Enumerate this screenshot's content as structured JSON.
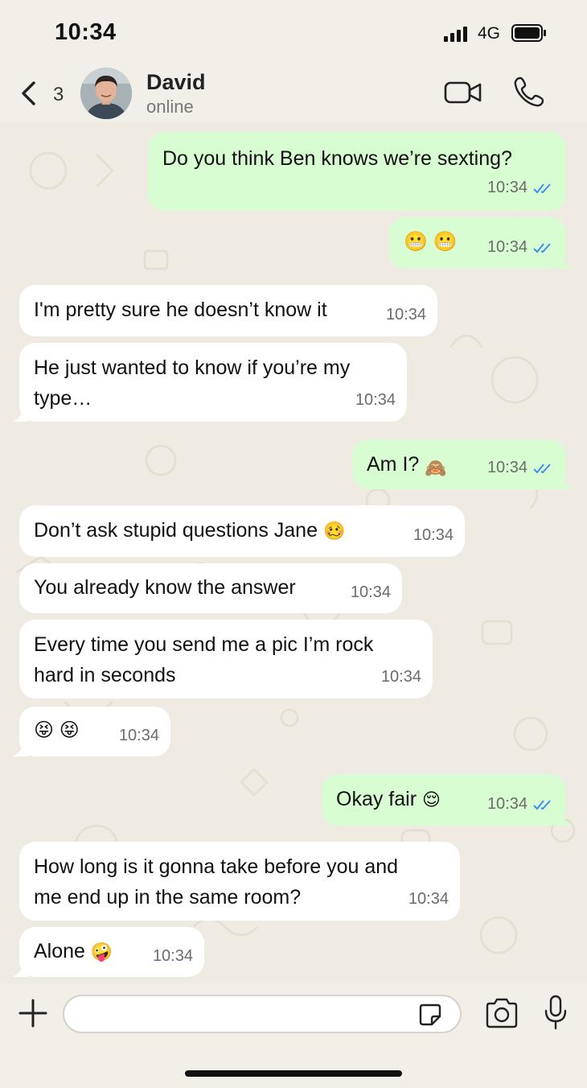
{
  "status": {
    "time": "10:34",
    "network": "4G"
  },
  "header": {
    "back_count": "3",
    "contact_name": "David",
    "contact_status": "online"
  },
  "messages": [
    {
      "direction": "out",
      "text": "Do you think Ben knows we’re sexting?",
      "time": "10:34",
      "read": true
    },
    {
      "direction": "out",
      "text": "😬 😬",
      "time": "10:34",
      "read": true
    },
    {
      "direction": "in",
      "text": "I'm pretty sure he doesn’t know it",
      "time": "10:34"
    },
    {
      "direction": "in",
      "text_lines": [
        "He just wanted to know if you’re my",
        "type…"
      ],
      "time": "10:34"
    },
    {
      "direction": "out",
      "text": "Am I?",
      "emoji": "🙈",
      "time": "10:34",
      "read": true
    },
    {
      "direction": "in",
      "text": "Don’t ask stupid questions Jane",
      "emoji": "🥴",
      "time": "10:34"
    },
    {
      "direction": "in",
      "text": "You already know the answer",
      "time": "10:34"
    },
    {
      "direction": "in",
      "text_lines": [
        "Every time you send me a pic I’m rock",
        "hard in seconds"
      ],
      "time": "10:34"
    },
    {
      "direction": "in",
      "text": "😝 😝",
      "time": "10:34"
    },
    {
      "direction": "out",
      "text": "Okay fair",
      "emoji": "😌",
      "time": "10:34",
      "read": true
    },
    {
      "direction": "in",
      "text_lines": [
        "How long is it gonna take before you and",
        "me end up in the same room?"
      ],
      "time": "10:34"
    },
    {
      "direction": "in",
      "text": "Alone",
      "emoji": "🤪",
      "time": "10:34"
    }
  ],
  "composer": {
    "input_value": ""
  },
  "colors": {
    "outgoing_bubble": "#d8fdd2",
    "incoming_bubble": "#ffffff",
    "chat_background": "#efeae2",
    "read_ticks": "#3d8ef0"
  }
}
